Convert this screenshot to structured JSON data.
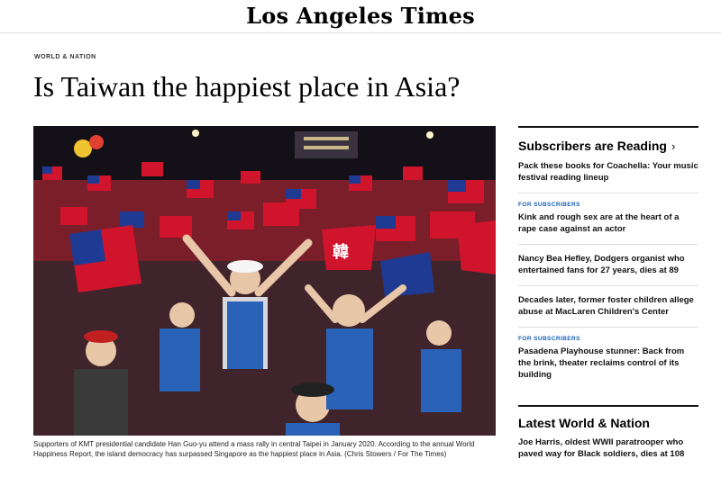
{
  "masthead": {
    "logo": "Los Angeles Times"
  },
  "article": {
    "section": "WORLD & NATION",
    "headline": "Is Taiwan the happiest place in Asia?",
    "photo_flag_text": "韓",
    "caption": "Supporters of KMT presidential candidate Han Guo-yu attend a mass rally in central Taipei in January 2020. According to the annual World Happiness Report, the island democracy has surpassed Singapore as the happiest place in Asia.  (Chris Stowers / For The Times)"
  },
  "sidebar": {
    "heading": "Subscribers are Reading",
    "chevron": "›",
    "stories": [
      {
        "badge": "",
        "title": "Pack these books for Coachella: Your music festival reading lineup"
      },
      {
        "badge": "FOR SUBSCRIBERS",
        "title": "Kink and rough sex are at the heart of a rape case against an actor"
      },
      {
        "badge": "",
        "title": "Nancy Bea Hefley, Dodgers organist who entertained fans for 27 years, dies at 89"
      },
      {
        "badge": "",
        "title": "Decades later, former foster children allege abuse at MacLaren Children's Center"
      },
      {
        "badge": "FOR SUBSCRIBERS",
        "title": "Pasadena Playhouse stunner: Back from the brink, theater reclaims control of its building"
      }
    ]
  },
  "latest": {
    "heading": "Latest World & Nation",
    "stories": [
      {
        "title": "Joe Harris, oldest WWII paratrooper who paved way for Black soldiers, dies at 108"
      }
    ]
  },
  "colors": {
    "badge": "#1a62b6",
    "flag_red": "#d0142c",
    "flag_blue": "#1f3a93"
  }
}
